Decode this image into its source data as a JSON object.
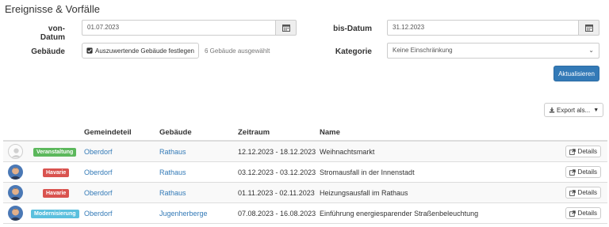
{
  "page": {
    "title": "Ereignisse & Vorfälle"
  },
  "filters": {
    "from_label": "von-Datum",
    "from_value": "01.07.2023",
    "to_label": "bis-Datum",
    "to_value": "31.12.2023",
    "buildings_label": "Gebäude",
    "buildings_button": "Auszuwertende Gebäude festlegen",
    "buildings_selected": "6 Gebäude ausgewählt",
    "category_label": "Kategorie",
    "category_value": "Keine Einschränkung",
    "refresh_button": "Aktualisieren"
  },
  "export": {
    "label": "Export als..."
  },
  "table": {
    "columns": [
      "",
      "Gemeindeteil",
      "Gebäude",
      "Zeitraum",
      "Name"
    ],
    "rows": [
      {
        "avatar": "placeholder",
        "badge": "Veranstaltung",
        "badge_color": "#5cb85c",
        "district": "Oberdorf",
        "building": "Rathaus",
        "period": "12.12.2023 - 18.12.2023",
        "name": "Weihnachtsmarkt",
        "action": "Details"
      },
      {
        "avatar": "photo",
        "badge": "Havarie",
        "badge_color": "#d9534f",
        "district": "Oberdorf",
        "building": "Rathaus",
        "period": "03.12.2023 - 03.12.2023",
        "name": "Stromausfall in der Innenstadt",
        "action": "Details"
      },
      {
        "avatar": "photo",
        "badge": "Havarie",
        "badge_color": "#d9534f",
        "district": "Oberdorf",
        "building": "Rathaus",
        "period": "01.11.2023 - 02.11.2023",
        "name": "Heizungsausfall im Rathaus",
        "action": "Details"
      },
      {
        "avatar": "photo",
        "badge": "Modernisierung",
        "badge_color": "#5bc0de",
        "district": "Oberdorf",
        "building": "Jugenherberge",
        "period": "07.08.2023 - 16.08.2023",
        "name": "Einführung energiesparender Straßenbeleuchtung",
        "action": "Details"
      }
    ]
  },
  "icons": {
    "calendar": "calendar-icon",
    "checkbox": "check-square-icon",
    "chevron": "chevron-down-icon",
    "download": "download-icon",
    "external": "external-link-icon",
    "user": "user-icon"
  },
  "colors": {
    "primary": "#337ab7",
    "link": "#337ab7",
    "success": "#5cb85c",
    "danger": "#d9534f",
    "info": "#5bc0de"
  }
}
